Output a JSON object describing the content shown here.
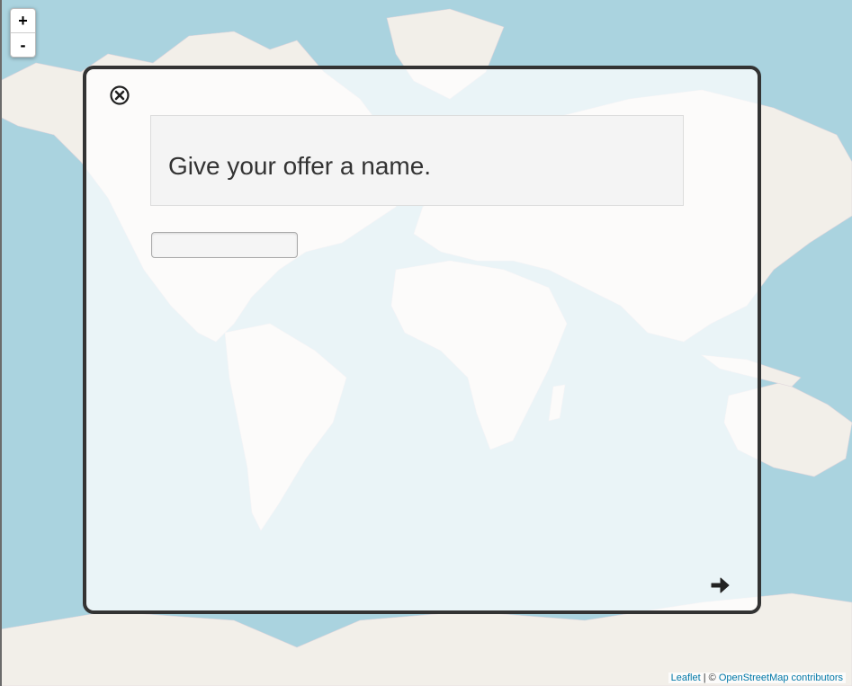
{
  "map": {
    "zoom_in_label": "+",
    "zoom_out_label": "-",
    "attribution": {
      "leaflet_link": "Leaflet",
      "separator": " | © ",
      "osm_link": "OpenStreetMap contributors"
    },
    "colors": {
      "water": "#aad3df",
      "land": "#f2efe9"
    }
  },
  "dialog": {
    "prompt": "Give your offer a name.",
    "name_input": {
      "value": "",
      "placeholder": ""
    },
    "close_icon": "close-circle-icon",
    "next_icon": "arrow-right-icon"
  }
}
